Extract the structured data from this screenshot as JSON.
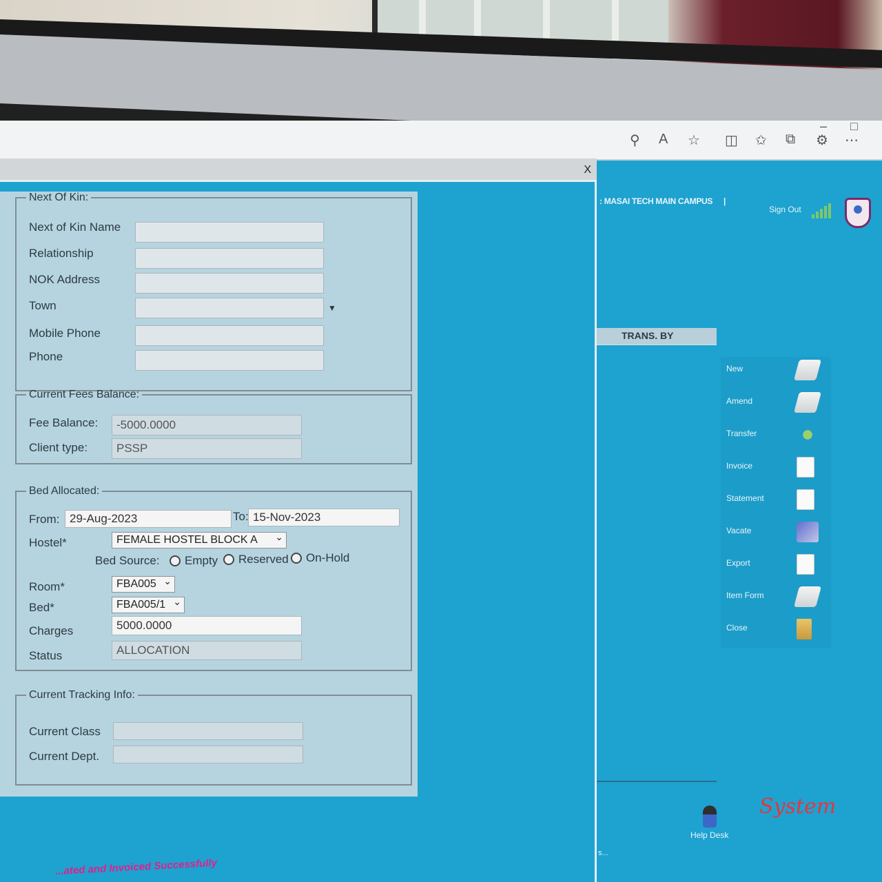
{
  "header": {
    "campus": ": MASAI TECH MAIN CAMPUS",
    "separator": "|",
    "sign_out": "Sign Out"
  },
  "dialog": {
    "close_label": "X",
    "next_of_kin": {
      "legend": "Next Of Kin:",
      "name_label": "Next of Kin Name",
      "relationship_label": "Relationship",
      "address_label": "NOK Address",
      "town_label": "Town",
      "mobile_label": "Mobile Phone",
      "phone_label": "Phone",
      "name_value": "",
      "relationship_value": "",
      "address_value": "",
      "town_value": "",
      "mobile_value": "",
      "phone_value": ""
    },
    "fees": {
      "legend": "Current Fees Balance:",
      "fee_label": "Fee Balance:",
      "fee_value": "-5000.0000",
      "client_label": "Client type:",
      "client_value": "PSSP"
    },
    "bed": {
      "legend": "Bed Allocated:",
      "from_label": "From:",
      "from_value": "29-Aug-2023",
      "to_label": "To:",
      "to_value": "15-Nov-2023",
      "hostel_label": "Hostel*",
      "hostel_value": "FEMALE HOSTEL BLOCK A",
      "bed_source_label": "Bed Source:",
      "opt_empty": "Empty",
      "opt_reserved": "Reserved",
      "opt_onhold": "On-Hold",
      "room_label": "Room*",
      "room_value": "FBA005",
      "bed_label": "Bed*",
      "bed_value": "FBA005/1",
      "charges_label": "Charges",
      "charges_value": "5000.0000",
      "status_label": "Status",
      "status_value": "ALLOCATION"
    },
    "tracking": {
      "legend": "Current Tracking Info:",
      "class_label": "Current Class",
      "dept_label": "Current Dept.",
      "class_value": "",
      "dept_value": ""
    }
  },
  "side": {
    "trans_by": "TRANS. BY",
    "actions": [
      {
        "label": "New",
        "icon": "computer-icon"
      },
      {
        "label": "Amend",
        "icon": "computer-icon"
      },
      {
        "label": "Transfer",
        "icon": "transfer-icon"
      },
      {
        "label": "Invoice",
        "icon": "document-icon"
      },
      {
        "label": "Statement",
        "icon": "document-icon"
      },
      {
        "label": "Vacate",
        "icon": "vacate-icon"
      },
      {
        "label": "Export",
        "icon": "document-icon"
      },
      {
        "label": "Item Form",
        "icon": "computer-icon"
      },
      {
        "label": "Close",
        "icon": "folder-exit-icon"
      }
    ],
    "help_desk": "Help Desk",
    "logo_text": "System"
  },
  "status_message": "...ated and Invoiced Successfully",
  "footer_mark": "s..."
}
